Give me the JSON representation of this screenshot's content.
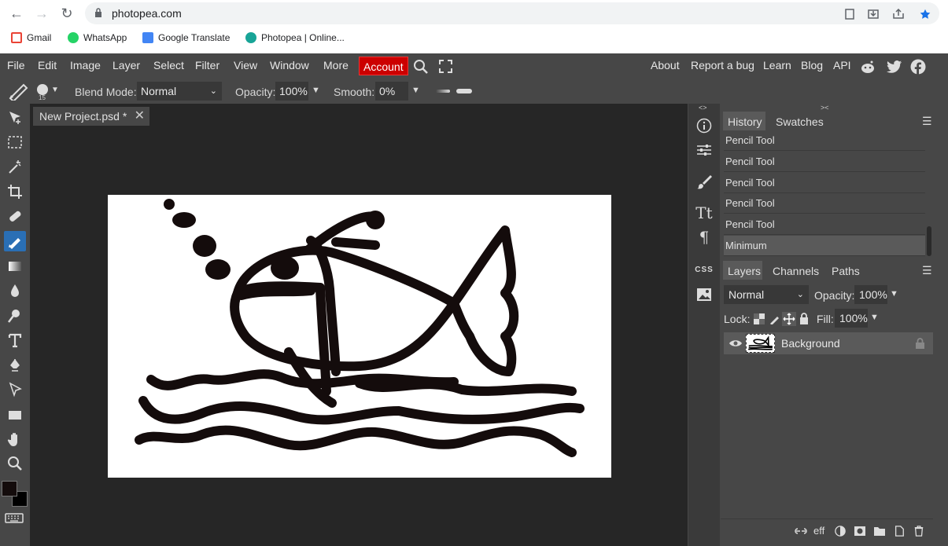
{
  "browser": {
    "url": "photopea.com",
    "bookmarks": [
      {
        "label": "Gmail",
        "icon": "gmail-icon"
      },
      {
        "label": "WhatsApp",
        "icon": "whatsapp-icon"
      },
      {
        "label": "Google Translate",
        "icon": "translate-icon"
      },
      {
        "label": "Photopea | Online...",
        "icon": "photopea-icon"
      }
    ]
  },
  "menu": {
    "items": [
      "File",
      "Edit",
      "Image",
      "Layer",
      "Select",
      "Filter",
      "View",
      "Window",
      "More"
    ],
    "account": "Account",
    "right": [
      "About",
      "Report a bug",
      "Learn",
      "Blog",
      "API"
    ]
  },
  "options": {
    "brush_size": "15",
    "blend_label": "Blend Mode:",
    "blend_value": "Normal",
    "opacity_label": "Opacity:",
    "opacity_value": "100%",
    "smooth_label": "Smooth:",
    "smooth_value": "0%"
  },
  "document": {
    "tab_title": "New Project.psd *",
    "close_glyph": "✕"
  },
  "history": {
    "tabs": [
      "History",
      "Swatches"
    ],
    "items": [
      "Pencil Tool",
      "Pencil Tool",
      "Pencil Tool",
      "Pencil Tool",
      "Pencil Tool",
      "Minimum"
    ]
  },
  "layers": {
    "tabs": [
      "Layers",
      "Channels",
      "Paths"
    ],
    "blend_value": "Normal",
    "opacity_label": "Opacity:",
    "opacity_value": "100%",
    "lock_label": "Lock:",
    "fill_label": "Fill:",
    "fill_value": "100%",
    "layer_name": "Background",
    "eff_label": "eff"
  },
  "colors": {
    "account_bg": "#cc0000",
    "foreground": "#140c0c",
    "background": "#000000",
    "canvas": "#ffffff"
  }
}
